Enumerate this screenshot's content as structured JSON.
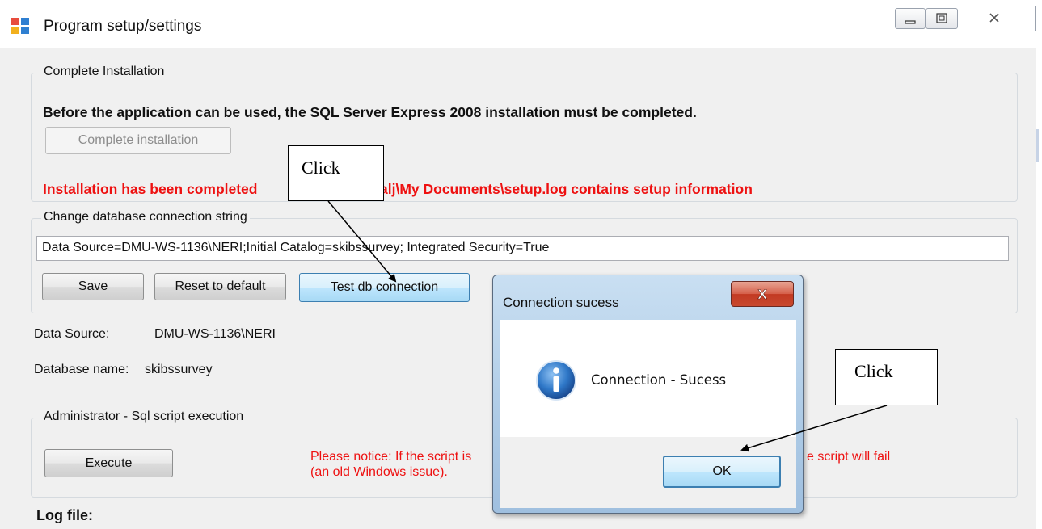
{
  "window": {
    "title": "Program setup/settings",
    "icon": "app-form-icon"
  },
  "complete_installation": {
    "group_title": "Complete Installation",
    "notice": "Before the application can be used, the SQL Server Express 2008 installation must be completed.",
    "button_label": "Complete installation",
    "status_left": "Installation has been completed",
    "status_right": "alj\\My Documents\\setup.log contains setup information"
  },
  "connection": {
    "group_title": "Change database connection string",
    "connection_string": "Data Source=DMU-WS-1136\\NERI;Initial Catalog=skibssurvey; Integrated Security=True",
    "save_label": "Save",
    "reset_label": "Reset to default",
    "test_label": "Test db connection"
  },
  "info": {
    "data_source_label": "Data Source:",
    "data_source_value": "DMU-WS-1136\\NERI",
    "database_name_label": "Database name:",
    "database_name_value": "skibssurvey"
  },
  "admin": {
    "group_title": "Administrator - Sql script execution",
    "execute_label": "Execute",
    "notice_line1_left": "Please notice: If the script is",
    "notice_line1_right": "e script will fail",
    "notice_line2": "(an old Windows issue)."
  },
  "log": {
    "label": "Log file:"
  },
  "dialog": {
    "title": "Connection sucess",
    "message": "Connection - Sucess",
    "ok_label": "OK",
    "close_glyph": "X"
  },
  "annotations": {
    "callout_1": "Click",
    "callout_2": "Click"
  },
  "colors": {
    "accent_red": "#ee1111",
    "dialog_frame": "#aecbe6",
    "info_icon": "#1e5fb4"
  }
}
